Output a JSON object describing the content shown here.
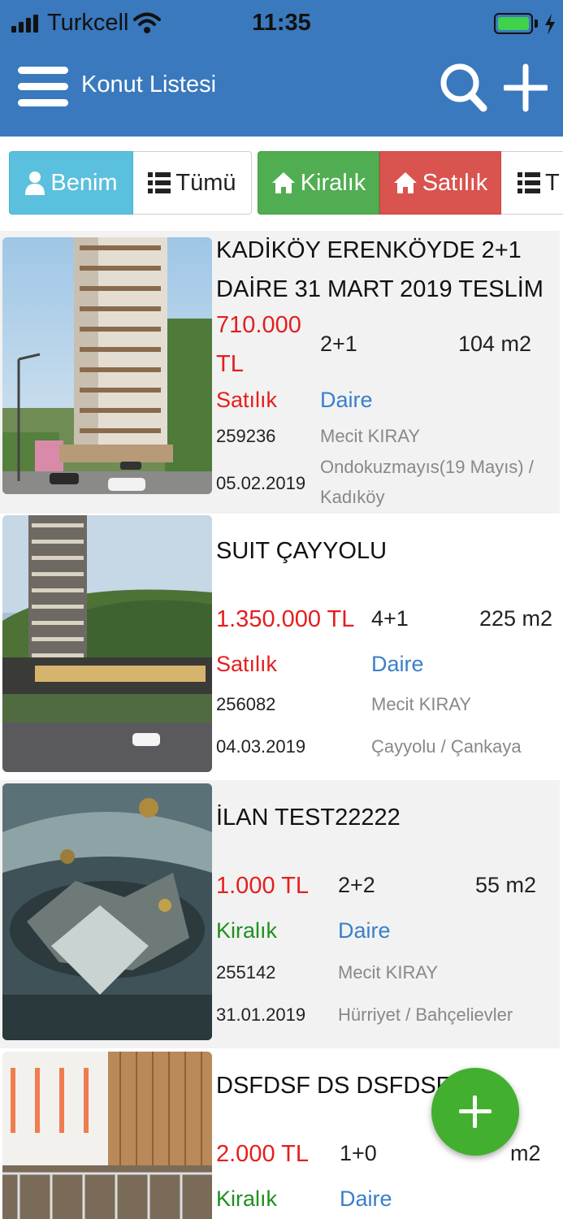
{
  "status_bar": {
    "carrier": "Turkcell",
    "time": "11:35"
  },
  "navbar": {
    "title": "Konut Listesi",
    "color": "#3a79bd"
  },
  "filters": {
    "mine_label": "Benim",
    "all_label": "Tümü",
    "rent_label": "Kiralık",
    "sale_label": "Satılık",
    "type_all_label": "T"
  },
  "listings": [
    {
      "title_line1": "KADİKÖY ERENKÖYDE 2+1",
      "title_line2": "DAİRE 31 MART 2019 TESLİM",
      "price_line1": "710.000",
      "price_line2": "TL",
      "rooms": "2+1",
      "area": "104 m2",
      "status": "Satılık",
      "type": "Daire",
      "ref": "259236",
      "agent": "Mecit KIRAY",
      "date": "05.02.2019",
      "location_line1": "Ondokuzmayıs(19 Mayıs) /",
      "location_line2": "Kadıköy"
    },
    {
      "title": "SUIT ÇAYYOLU",
      "price": "1.350.000 TL",
      "rooms": "4+1",
      "area": "225 m2",
      "status": "Satılık",
      "type": "Daire",
      "ref": "256082",
      "agent": "Mecit KIRAY",
      "date": "04.03.2019",
      "location": "Çayyolu / Çankaya"
    },
    {
      "title": "İLAN TEST22222",
      "price": "1.000 TL",
      "rooms": "2+2",
      "area": "55 m2",
      "status": "Kiralık",
      "type": "Daire",
      "ref": "255142",
      "agent": "Mecit KIRAY",
      "date": "31.01.2019",
      "location": "Hürriyet / Bahçelievler"
    },
    {
      "title": "DSFDSF DS DSFDSFD",
      "price": "2.000 TL",
      "rooms": "1+0",
      "area": "m2",
      "status": "Kiralık",
      "type": "Daire"
    }
  ],
  "colors": {
    "price": "#e51e1e",
    "rent": "#1f8f1f",
    "type": "#3a7fc9",
    "fab": "#42b02e"
  }
}
